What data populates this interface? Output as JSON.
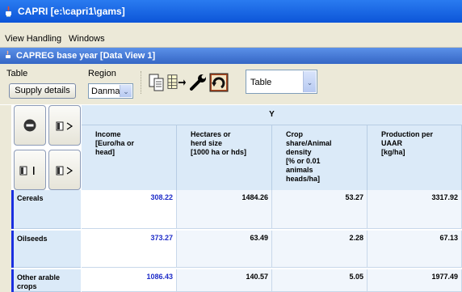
{
  "window": {
    "title": "CAPRI [e:\\capri1\\gams]"
  },
  "menu": {
    "items": [
      "View Handling",
      "Windows"
    ]
  },
  "inner_window": {
    "title": "CAPREG base year [Data View 1]"
  },
  "toolbar": {
    "table_label": "Table",
    "supply_button": "Supply details",
    "region_label": "Region",
    "region_value": "Danmark",
    "view_value": "Table"
  },
  "table": {
    "top_header": "Y",
    "columns": [
      {
        "label": "Income\n[Euro/ha or\nhead]"
      },
      {
        "label": "Hectares or\nherd size\n[1000 ha or hds]"
      },
      {
        "label": "Crop\nshare/Animal\ndensity\n[% or 0.01\nanimals\nheads/ha]"
      },
      {
        "label": "Production per\nUAAR\n[kg/ha]"
      }
    ],
    "rows": [
      {
        "label": "Cereals",
        "values": [
          "308.22",
          "1484.26",
          "53.27",
          "3317.92"
        ]
      },
      {
        "label": "Oilseeds",
        "values": [
          "373.27",
          "63.49",
          "2.28",
          "67.13"
        ]
      },
      {
        "label": "Other arable\ncrops",
        "values": [
          "1086.43",
          "140.57",
          "5.05",
          "1977.49"
        ]
      }
    ]
  },
  "colors": {
    "title_blue": "#0c55d8",
    "header_bg": "#dbeaf8",
    "income_text": "#1e2cc8"
  }
}
